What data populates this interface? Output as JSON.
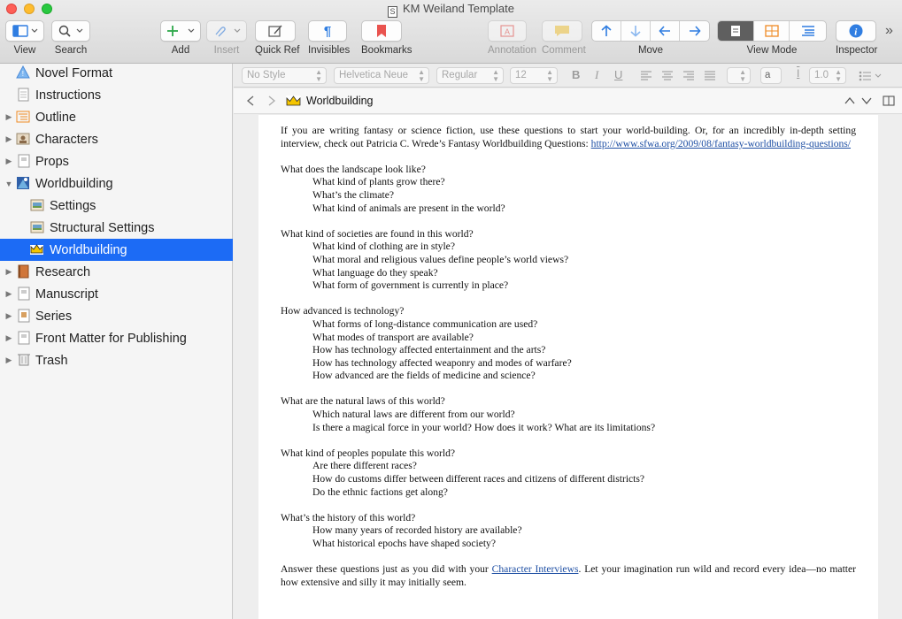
{
  "window": {
    "title": "KM Weiland Template"
  },
  "toolbar": {
    "view": "View",
    "search": "Search",
    "add": "Add",
    "insert": "Insert",
    "quick_ref": "Quick Ref",
    "invisibles": "Invisibles",
    "bookmarks": "Bookmarks",
    "annotation": "Annotation",
    "comment": "Comment",
    "move": "Move",
    "view_mode": "View Mode",
    "inspector": "Inspector",
    "overflow": "»"
  },
  "sidebar": {
    "items": [
      {
        "label": "Novel Format",
        "icon": "warning-triangle-icon"
      },
      {
        "label": "Instructions",
        "icon": "document-icon"
      },
      {
        "label": "Outline",
        "icon": "outline-icon"
      },
      {
        "label": "Characters",
        "icon": "character-card-icon"
      },
      {
        "label": "Props",
        "icon": "folder-icon"
      },
      {
        "label": "Worldbuilding",
        "icon": "globe-folder-icon"
      },
      {
        "label": "Settings",
        "icon": "settings-card-icon"
      },
      {
        "label": "Structural Settings",
        "icon": "settings-card-icon"
      },
      {
        "label": "Worldbuilding",
        "icon": "crown-icon"
      },
      {
        "label": "Research",
        "icon": "book-icon"
      },
      {
        "label": "Manuscript",
        "icon": "folder-icon"
      },
      {
        "label": "Series",
        "icon": "series-card-icon"
      },
      {
        "label": "Front Matter for Publishing",
        "icon": "folder-icon"
      },
      {
        "label": "Trash",
        "icon": "trash-icon"
      }
    ]
  },
  "formatbar": {
    "style": "No Style",
    "font": "Helvetica Neue",
    "weight": "Regular",
    "size": "12",
    "bold": "B",
    "italic": "I",
    "underline": "U",
    "text_color": "a",
    "line_spacing": "1.0"
  },
  "header": {
    "title": "Worldbuilding"
  },
  "document": {
    "intro": "If you are writing fantasy or science fiction, use these questions to start your world-building. Or, for an incredibly in-depth setting interview, check out Patricia C. Wrede’s Fantasy Worldbuilding Questions: ",
    "intro_link": "http://www.sfwa.org/2009/08/fantasy-worldbuilding-questions/",
    "sections": [
      {
        "q": "What does the landscape look like?",
        "subs": [
          "What kind of plants grow there?",
          "What’s the climate?",
          "What kind of animals are present in the world?"
        ]
      },
      {
        "q": "What kind of societies are found in this world?",
        "subs": [
          "What kind of clothing are in style?",
          "What moral and religious values define people’s world views?",
          "What language do they speak?",
          "What form of government is currently in place?"
        ]
      },
      {
        "q": "How advanced is technology?",
        "subs": [
          "What forms of long-distance communication are used?",
          "What modes of transport are available?",
          "How has technology affected entertainment and the arts?",
          "How has technology affected weaponry and modes of warfare?",
          "How advanced are the fields of medicine and science?"
        ]
      },
      {
        "q": "What are the natural laws of this world?",
        "subs": [
          "Which natural laws are different from our world?",
          "Is there a magical force in your world? How does it work? What are its limitations?"
        ]
      },
      {
        "q": "What kind of peoples populate this world?",
        "subs": [
          "Are there different races?",
          "How do customs differ between different races and citizens of different districts?",
          "Do the ethnic factions get along?"
        ]
      },
      {
        "q": "What’s the history of this world?",
        "subs": [
          "How many years of recorded history are available?",
          "What historical epochs have shaped society?"
        ]
      }
    ],
    "outro_pre": "Answer these questions just as you did with your ",
    "outro_link": "Character Interviews",
    "outro_post": ". Let your imagination run wild and record every idea—no matter how extensive and silly it may initially seem."
  },
  "colors": {
    "selection": "#1c6bf5",
    "accent_blue": "#2f7de1"
  }
}
